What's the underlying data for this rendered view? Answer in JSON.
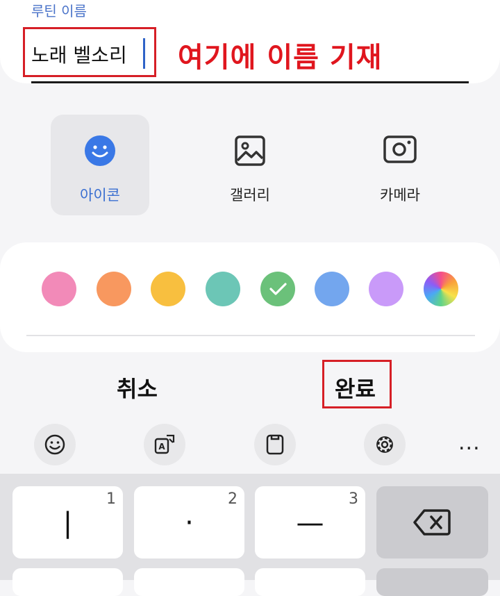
{
  "routine": {
    "field_label": "루틴 이름",
    "name_value": "노래 벨소리",
    "annotation": "여기에 이름 기재"
  },
  "image_options": [
    {
      "label": "아이콘",
      "icon": "smiley-icon",
      "selected": true
    },
    {
      "label": "갤러리",
      "icon": "gallery-icon",
      "selected": false
    },
    {
      "label": "카메라",
      "icon": "camera-icon",
      "selected": false
    }
  ],
  "colors": {
    "swatches": [
      "#f28ab8",
      "#f8985f",
      "#f8bf3f",
      "#6cc6b6",
      "#6bc17a",
      "#73a6ee",
      "#c99af9",
      "gradient"
    ],
    "selected_index": 4,
    "accent": "#3a6fd1"
  },
  "actions": {
    "cancel_label": "취소",
    "done_label": "완료"
  },
  "keyboard": {
    "toolbar": [
      "emoji-icon",
      "translate-icon",
      "clipboard-icon",
      "settings-icon",
      "more-icon"
    ],
    "more_label": "...",
    "keys": [
      {
        "num": "1",
        "glyph": "|"
      },
      {
        "num": "2",
        "glyph": "·"
      },
      {
        "num": "3",
        "glyph": "—"
      }
    ],
    "backspace": "backspace-icon"
  }
}
